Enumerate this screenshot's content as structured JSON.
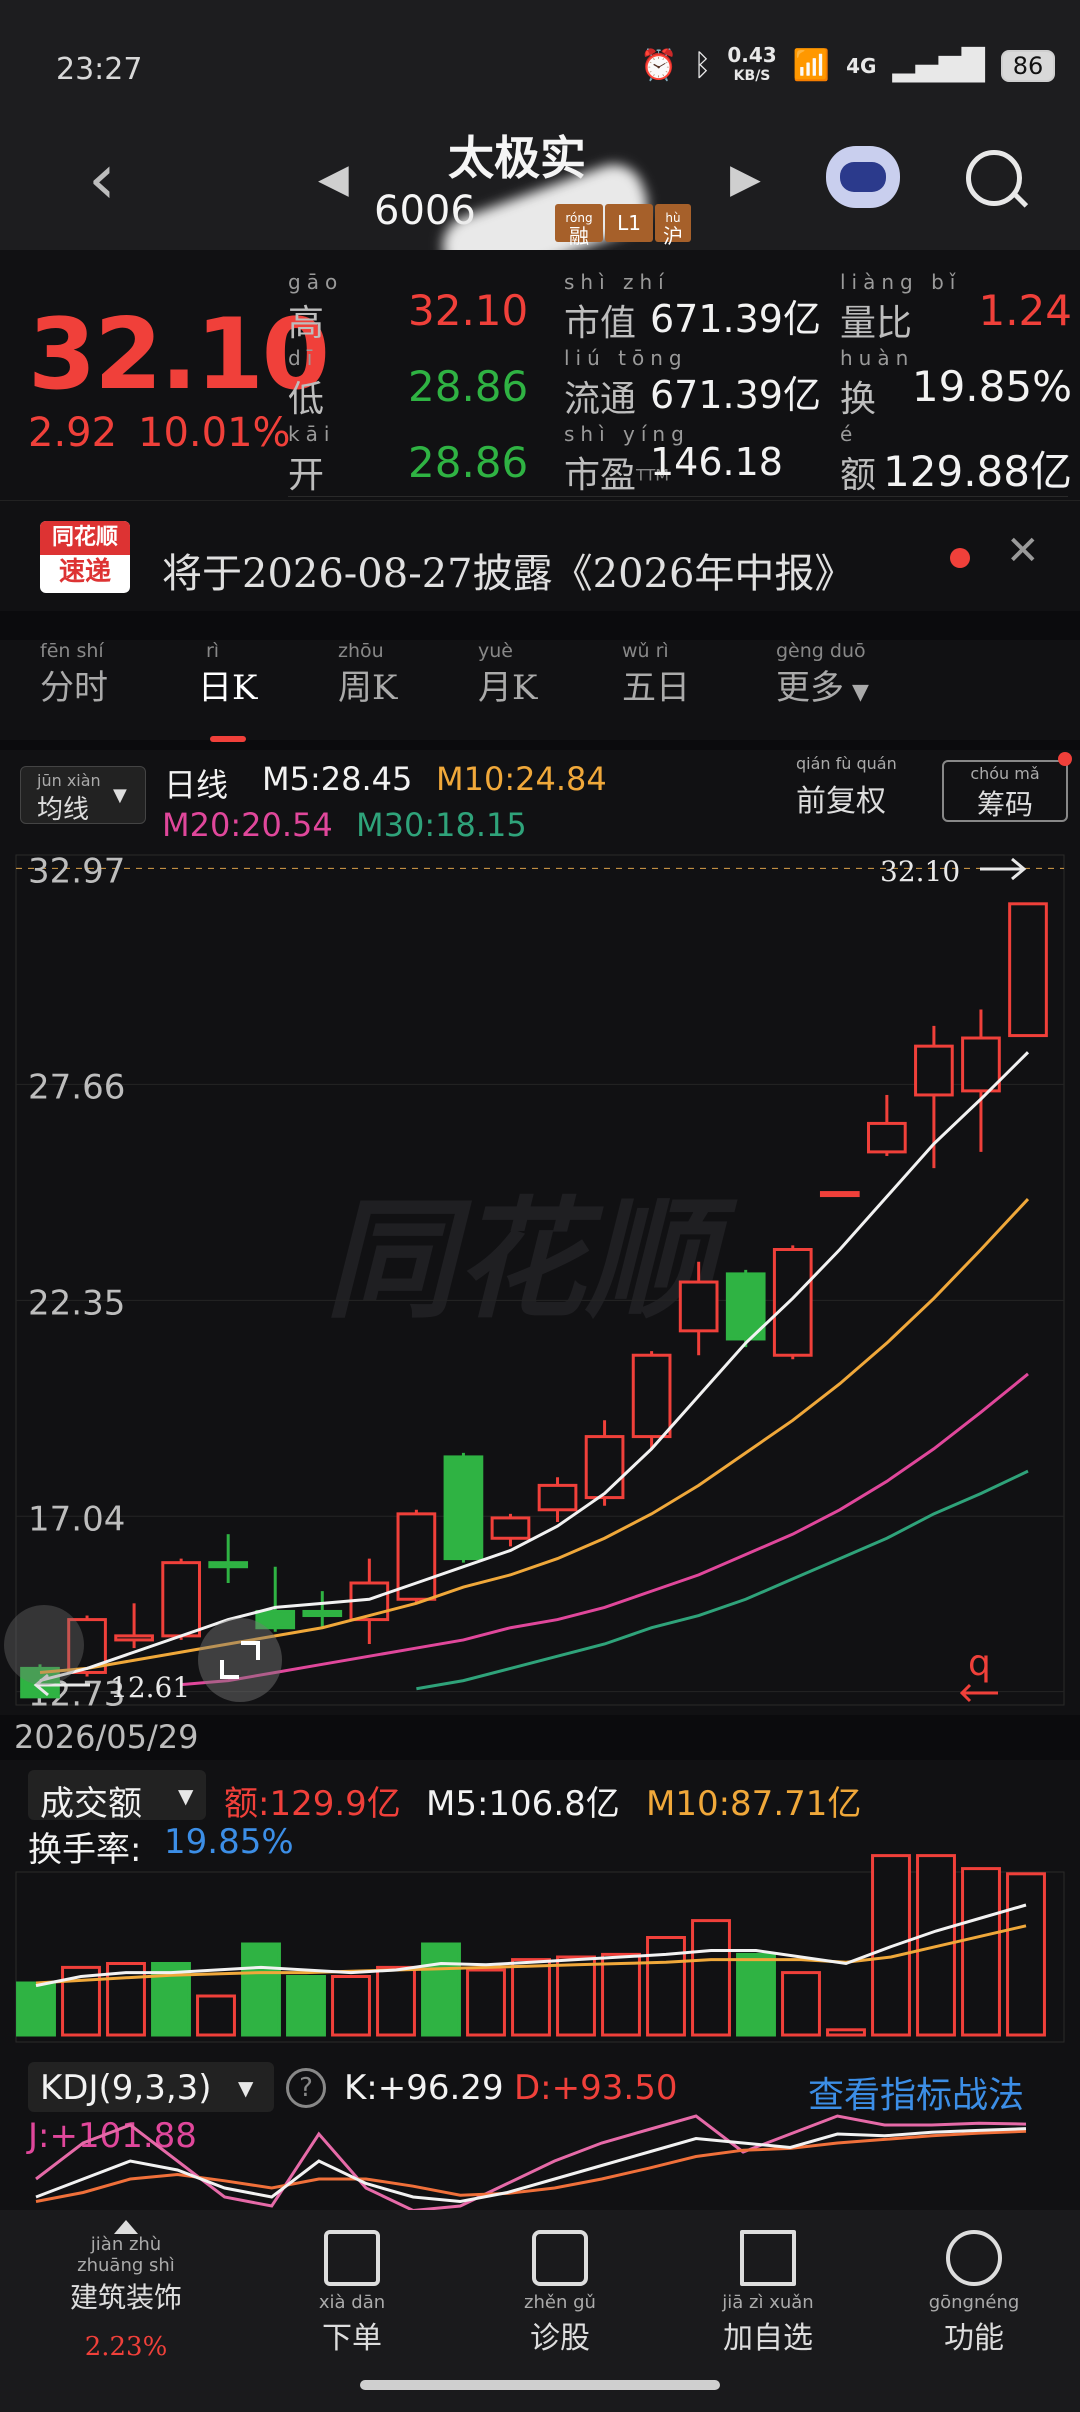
{
  "status": {
    "time": "23:27",
    "net_speed": "0.43",
    "net_unit": "KB/S",
    "signal": "4G",
    "battery": "86"
  },
  "header": {
    "name": "太极实",
    "code": "6006",
    "tags": [
      {
        "py": "róng",
        "text": "融"
      },
      {
        "py": "",
        "text": "L1"
      },
      {
        "py": "hù",
        "text": "沪"
      }
    ]
  },
  "quote": {
    "price": "32.10",
    "change": "2.92",
    "change_pct": "10.01%",
    "rows": [
      {
        "py": "gāo",
        "label": "高",
        "value": "32.10",
        "color": "#f0403a",
        "py2": "shì zhí",
        "label2": "市值",
        "value2": "671.39亿",
        "py3": "liàng bǐ",
        "label3": "量比",
        "value3": "1.24",
        "color3": "#f0403a"
      },
      {
        "py": "dī",
        "label": "低",
        "value": "28.86",
        "color": "#2fb343",
        "py2": "liú tōng",
        "label2": "流通",
        "value2": "671.39亿",
        "py3": "huàn",
        "label3": "换",
        "value3": "19.85%",
        "color3": "#f2f2f2"
      },
      {
        "py": "kāi",
        "label": "开",
        "value": "28.86",
        "color": "#2fb343",
        "py2": "shì yíng",
        "label2": "市盈",
        "sup2": "TTM",
        "value2": "146.18",
        "py3": "é",
        "label3": "额",
        "value3": "129.88亿",
        "color3": "#f2f2f2"
      }
    ]
  },
  "news": {
    "logo_top": "同花顺",
    "logo_bottom": "速递",
    "text": "将于2026-08-27披露《2026年中报》"
  },
  "tabs": [
    {
      "py": "fēn shí",
      "label": "分时"
    },
    {
      "py": "rì",
      "label": "日K"
    },
    {
      "py": "zhōu",
      "label": "周K"
    },
    {
      "py": "yuè",
      "label": "月K"
    },
    {
      "py": "wǔ rì",
      "label": "五日"
    },
    {
      "py": "gèng duō",
      "label": "更多"
    }
  ],
  "chart_head": {
    "ma_selector": "均线",
    "ma_selector_py": "jūn xiàn",
    "period": "日线",
    "m5": "M5:28.45",
    "m10": "M10:24.84",
    "m20": "M20:20.54",
    "m30": "M30:18.15",
    "adjust": "前复权",
    "adjust_py": "qián fù quán",
    "chips": "筹码",
    "chips_py": "chóu mǎ"
  },
  "chart_data": {
    "type": "candlestick",
    "y_ticks": [
      "32.97",
      "27.66",
      "22.35",
      "17.04",
      "12.73"
    ],
    "ylim": [
      12.4,
      33.3
    ],
    "high_label": "32.10",
    "low_label": "12.61",
    "start_date": "2026/05/29",
    "watermark": "同花顺",
    "candles": [
      {
        "o": 13.3,
        "c": 12.6,
        "h": 13.4,
        "l": 12.6
      },
      {
        "o": 13.2,
        "c": 14.5,
        "h": 14.6,
        "l": 13.1
      },
      {
        "o": 14.0,
        "c": 14.1,
        "h": 14.9,
        "l": 13.8
      },
      {
        "o": 14.1,
        "c": 15.9,
        "h": 16.0,
        "l": 14.0
      },
      {
        "o": 15.9,
        "c": 15.8,
        "h": 16.6,
        "l": 15.4
      },
      {
        "o": 14.7,
        "c": 14.3,
        "h": 15.8,
        "l": 14.2
      },
      {
        "o": 14.7,
        "c": 14.6,
        "h": 15.2,
        "l": 14.3
      },
      {
        "o": 14.5,
        "c": 15.4,
        "h": 16.0,
        "l": 13.9
      },
      {
        "o": 15.0,
        "c": 17.1,
        "h": 17.2,
        "l": 14.9
      },
      {
        "o": 18.5,
        "c": 16.0,
        "h": 18.6,
        "l": 15.9
      },
      {
        "o": 16.5,
        "c": 17.0,
        "h": 17.1,
        "l": 16.3
      },
      {
        "o": 17.2,
        "c": 17.8,
        "h": 18.0,
        "l": 16.9
      },
      {
        "o": 17.5,
        "c": 19.0,
        "h": 19.4,
        "l": 17.3
      },
      {
        "o": 19.0,
        "c": 21.0,
        "h": 21.1,
        "l": 18.7
      },
      {
        "o": 21.6,
        "c": 22.8,
        "h": 23.3,
        "l": 21.0
      },
      {
        "o": 23.0,
        "c": 21.4,
        "h": 23.1,
        "l": 21.2
      },
      {
        "o": 21.0,
        "c": 23.6,
        "h": 23.7,
        "l": 20.9
      },
      {
        "o": 25.0,
        "c": 25.0,
        "h": 25.0,
        "l": 25.0
      },
      {
        "o": 26.0,
        "c": 26.7,
        "h": 27.4,
        "l": 25.9
      },
      {
        "o": 27.4,
        "c": 28.6,
        "h": 29.1,
        "l": 25.6
      },
      {
        "o": 27.5,
        "c": 28.8,
        "h": 29.5,
        "l": 26.0
      },
      {
        "o": 28.86,
        "c": 32.1,
        "h": 32.1,
        "l": 28.86
      }
    ],
    "m5": [
      13.0,
      13.3,
      13.7,
      14.1,
      14.5,
      14.8,
      14.9,
      15.0,
      15.4,
      15.8,
      16.2,
      16.8,
      17.6,
      18.7,
      20.0,
      21.3,
      22.4,
      23.6,
      24.9,
      26.2,
      27.3,
      28.45
    ],
    "m10": [
      13.2,
      13.3,
      13.5,
      13.7,
      13.9,
      14.1,
      14.3,
      14.6,
      14.9,
      15.3,
      15.6,
      16.0,
      16.5,
      17.1,
      17.8,
      18.6,
      19.4,
      20.3,
      21.3,
      22.4,
      23.6,
      24.84
    ],
    "m20": [
      null,
      null,
      null,
      12.9,
      13.0,
      13.2,
      13.4,
      13.6,
      13.8,
      14.0,
      14.3,
      14.5,
      14.8,
      15.2,
      15.6,
      16.1,
      16.6,
      17.2,
      17.9,
      18.7,
      19.6,
      20.54
    ],
    "m30": [
      null,
      null,
      null,
      null,
      null,
      null,
      null,
      null,
      12.8,
      13.0,
      13.3,
      13.6,
      13.9,
      14.3,
      14.6,
      15.0,
      15.5,
      16.0,
      16.5,
      17.1,
      17.6,
      18.15
    ]
  },
  "volume": {
    "selector": "成交额",
    "amount": "额:129.9亿",
    "m5": "M5:106.8亿",
    "m10": "M10:87.71亿",
    "turnover_label": "换手率:",
    "turnover": "19.85%",
    "bars": [
      40,
      52,
      55,
      55,
      30,
      70,
      45,
      45,
      52,
      70,
      50,
      58,
      60,
      62,
      75,
      88,
      62,
      48,
      4,
      138,
      138,
      128,
      124
    ],
    "up": [
      false,
      true,
      true,
      false,
      true,
      false,
      false,
      true,
      true,
      false,
      true,
      true,
      true,
      true,
      true,
      true,
      false,
      true,
      true,
      true,
      true,
      true,
      true
    ],
    "ma5": [
      38,
      45,
      48,
      48,
      50,
      52,
      50,
      48,
      50,
      55,
      54,
      56,
      58,
      60,
      62,
      65,
      65,
      60,
      55,
      68,
      80,
      90,
      100
    ],
    "ma10": [
      40,
      42,
      44,
      46,
      47,
      48,
      48,
      49,
      50,
      51,
      52,
      53,
      54,
      55,
      56,
      58,
      58,
      58,
      56,
      60,
      68,
      76,
      84
    ]
  },
  "kdj": {
    "selector": "KDJ(9,3,3)",
    "k": "K:+96.29",
    "d": "D:+93.50",
    "j": "J:+101.88",
    "link": "查看指标战法",
    "k_line": [
      20,
      40,
      60,
      50,
      30,
      20,
      60,
      35,
      20,
      15,
      25,
      40,
      55,
      70,
      85,
      80,
      75,
      90,
      88,
      92,
      94,
      96
    ],
    "d_line": [
      15,
      25,
      40,
      45,
      38,
      30,
      40,
      40,
      32,
      22,
      24,
      30,
      40,
      52,
      65,
      72,
      74,
      80,
      84,
      88,
      91,
      93
    ],
    "j_line": [
      40,
      80,
      100,
      60,
      20,
      10,
      90,
      30,
      5,
      10,
      35,
      60,
      80,
      95,
      110,
      70,
      90,
      110,
      100,
      100,
      102,
      101
    ]
  },
  "nav": [
    {
      "py": "jiàn zhù zhuāng shì",
      "label": "建筑装饰",
      "sub": "2.23%"
    },
    {
      "py": "xià dān",
      "label": "下单"
    },
    {
      "py": "zhěn gǔ",
      "label": "诊股"
    },
    {
      "py": "jiā zì xuǎn",
      "label": "加自选"
    },
    {
      "py": "gōngnéng",
      "label": "功能"
    }
  ]
}
